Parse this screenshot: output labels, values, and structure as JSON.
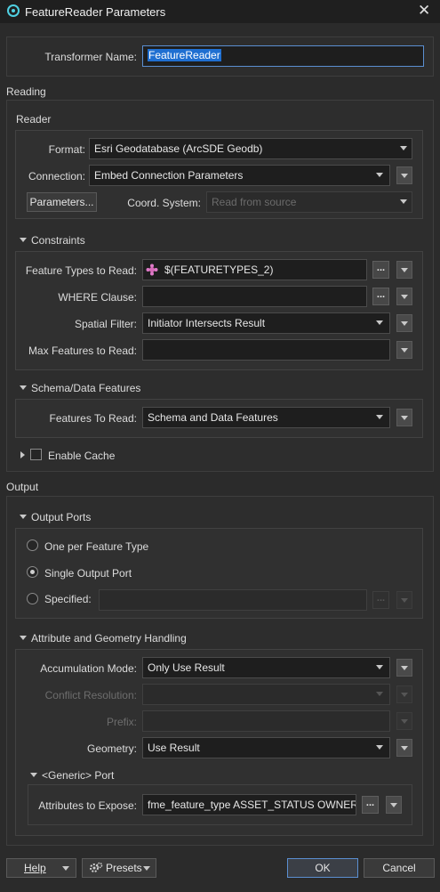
{
  "window": {
    "title": "FeatureReader Parameters"
  },
  "transformer_name": {
    "label": "Transformer Name:",
    "value": "FeatureReader"
  },
  "sections": {
    "reading": "Reading",
    "output": "Output"
  },
  "reader": {
    "title": "Reader",
    "format_label": "Format:",
    "format_value": "Esri Geodatabase (ArcSDE Geodb)",
    "connection_label": "Connection:",
    "connection_value": "Embed Connection Parameters",
    "parameters_button": "Parameters...",
    "coord_label": "Coord. System:",
    "coord_placeholder": "Read from source"
  },
  "constraints": {
    "title": "Constraints",
    "feature_types_label": "Feature Types to Read:",
    "feature_types_value": "$(FEATURETYPES_2)",
    "where_label": "WHERE Clause:",
    "where_value": "",
    "spatial_label": "Spatial Filter:",
    "spatial_value": "Initiator Intersects Result",
    "max_label": "Max Features to Read:",
    "max_value": ""
  },
  "schema": {
    "title": "Schema/Data Features",
    "features_label": "Features To Read:",
    "features_value": "Schema and Data Features"
  },
  "cache": {
    "label": "Enable Cache",
    "checked": false
  },
  "output_ports": {
    "title": "Output Ports",
    "opt1": "One per Feature Type",
    "opt2": "Single Output Port",
    "opt3": "Specified:",
    "selected": "Single Output Port"
  },
  "attr_geom": {
    "title": "Attribute and Geometry Handling",
    "accum_label": "Accumulation Mode:",
    "accum_value": "Only Use Result",
    "conflict_label": "Conflict Resolution:",
    "prefix_label": "Prefix:",
    "geometry_label": "Geometry:",
    "geometry_value": "Use Result"
  },
  "generic_port": {
    "title": "<Generic> Port",
    "attrs_label": "Attributes to Expose:",
    "attrs_value": "fme_feature_type ASSET_STATUS OWNER"
  },
  "buttons": {
    "help": "Help",
    "presets": "Presets",
    "ok": "OK",
    "cancel": "Cancel"
  },
  "dots": "...",
  "colors": {
    "accent": "#4fd0e2",
    "selection": "#1f6fd1",
    "focus_border": "#5b8fd1"
  }
}
